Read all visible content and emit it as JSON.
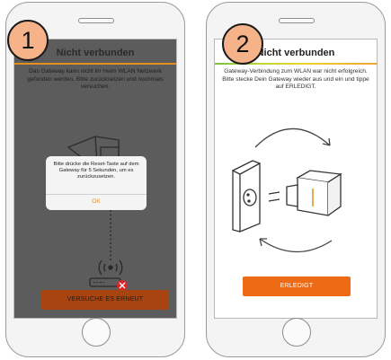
{
  "steps": [
    "1",
    "2"
  ],
  "screen1": {
    "title": "Nicht verbunden",
    "message": "Das Gateway kann nicht im Heim WLAN Netzwerk gefunden werden. Bitte zurücksetzen und nochmals versuchen.",
    "dialog": {
      "message": "Bitte drücke die Reset-Taste auf dem Gateway für 5 Sekunden, um es zurückzusetzen.",
      "ok_label": "OK"
    },
    "retry_label": "VERSUCHE ES ERNEUT"
  },
  "screen2": {
    "title": "Nicht verbunden",
    "message": "Gateway-Verbindung zum WLAN war nicht erfolgreich. Bitte stecke Dein Gateway wieder aus und ein und tippe auf ERLEDIGT.",
    "done_label": "ERLEDIGT"
  },
  "colors": {
    "accent": "#ef6a14",
    "dark_accent": "#a8440f",
    "step_circle": "#f6b289",
    "error_red": "#d9262c"
  }
}
